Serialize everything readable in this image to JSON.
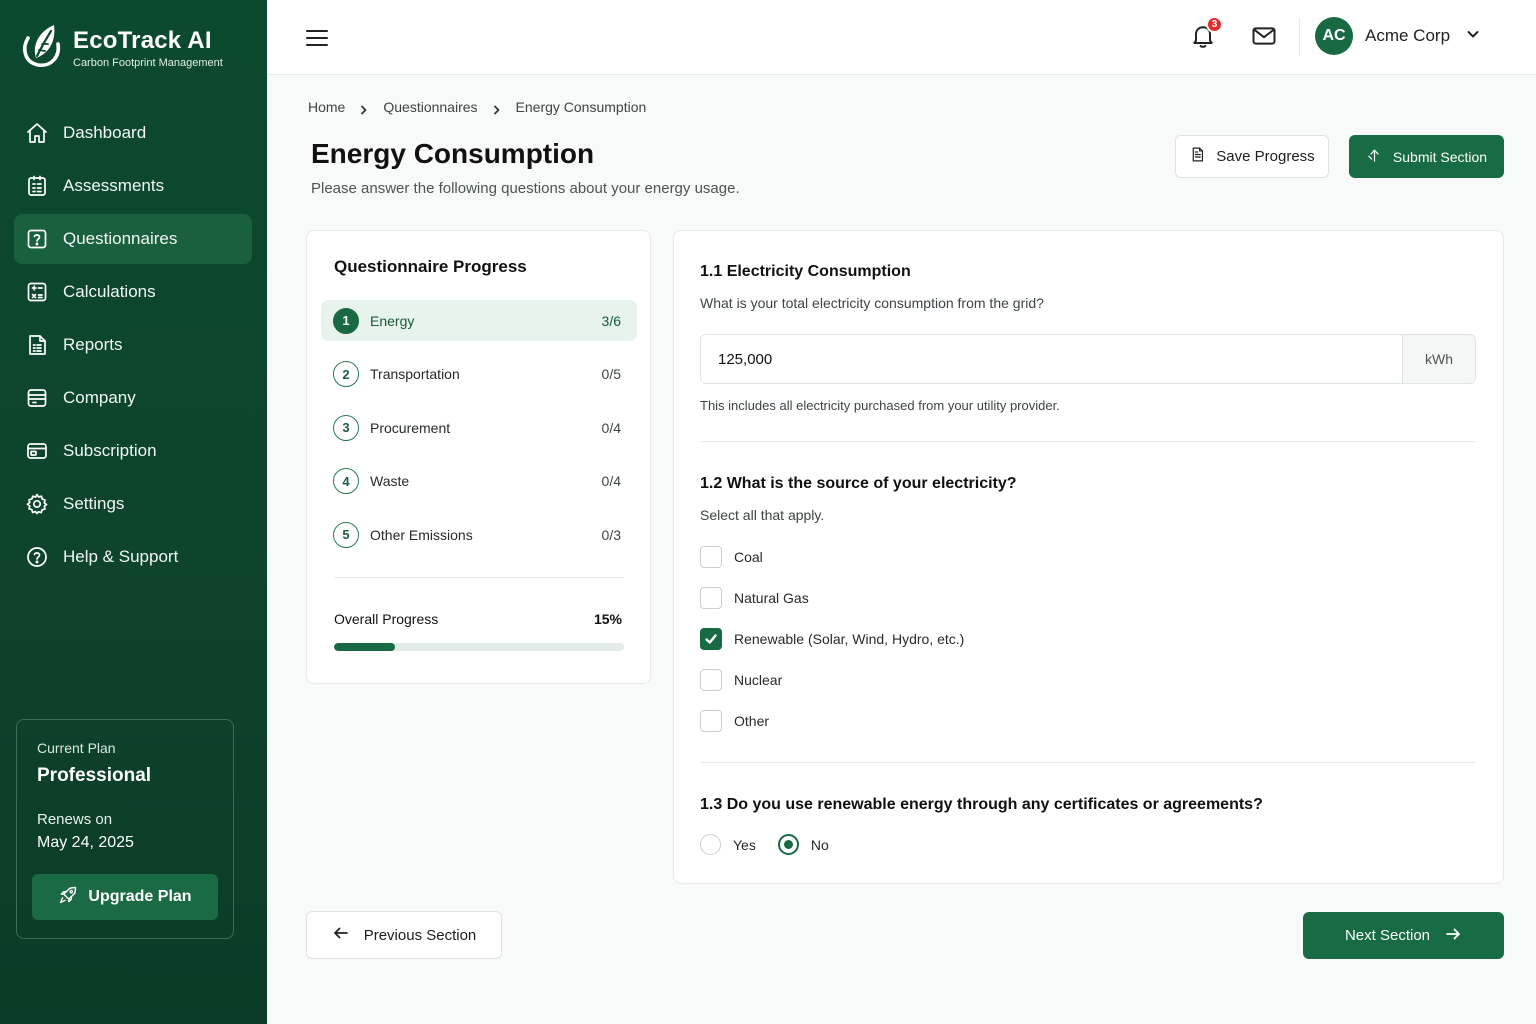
{
  "brand": {
    "name": "EcoTrack AI",
    "tagline": "Carbon Footprint Management",
    "logo_icon": "leaf-icon"
  },
  "sidebar": {
    "items": [
      {
        "label": "Dashboard",
        "icon": "home-icon",
        "active": false
      },
      {
        "label": "Assessments",
        "icon": "clipboard-icon",
        "active": false
      },
      {
        "label": "Questionnaires",
        "icon": "question-square-icon",
        "active": true
      },
      {
        "label": "Calculations",
        "icon": "calculator-icon",
        "active": false
      },
      {
        "label": "Reports",
        "icon": "report-icon",
        "active": false
      },
      {
        "label": "Company",
        "icon": "building-icon",
        "active": false
      },
      {
        "label": "Subscription",
        "icon": "card-icon",
        "active": false
      },
      {
        "label": "Settings",
        "icon": "gear-icon",
        "active": false
      },
      {
        "label": "Help & Support",
        "icon": "help-circle-icon",
        "active": false
      }
    ],
    "plan": {
      "label": "Current Plan",
      "name": "Professional",
      "renews_label": "Renews on",
      "renews_date": "May 24, 2025",
      "upgrade_label": "Upgrade Plan"
    }
  },
  "topbar": {
    "notification_count": "3",
    "user_initials": "AC",
    "user_name": "Acme Corp"
  },
  "breadcrumb": [
    "Home",
    "Questionnaires",
    "Energy Consumption"
  ],
  "header": {
    "title": "Energy Consumption",
    "subtitle": "Please answer the following questions about your energy usage.",
    "save_label": "Save Progress",
    "submit_label": "Submit Section"
  },
  "progress": {
    "title": "Questionnaire Progress",
    "steps": [
      {
        "num": "1",
        "label": "Energy",
        "count": "3/6",
        "active": true
      },
      {
        "num": "2",
        "label": "Transportation",
        "count": "0/5",
        "active": false
      },
      {
        "num": "3",
        "label": "Procurement",
        "count": "0/4",
        "active": false
      },
      {
        "num": "4",
        "label": "Waste",
        "count": "0/4",
        "active": false
      },
      {
        "num": "5",
        "label": "Other Emissions",
        "count": "0/3",
        "active": false
      }
    ],
    "overall_label": "Overall Progress",
    "overall_value": "15%",
    "overall_fraction": 0.21
  },
  "questions": {
    "q1": {
      "title": "1.1 Electricity Consumption",
      "prompt": "What is your total electricity consumption from the grid?",
      "value": "125,000",
      "unit": "kWh",
      "help": "This includes all electricity purchased from your utility provider."
    },
    "q2": {
      "title": "1.2 What is the source of your electricity?",
      "prompt": "Select all that apply.",
      "options": [
        {
          "label": "Coal",
          "checked": false
        },
        {
          "label": "Natural Gas",
          "checked": false
        },
        {
          "label": "Renewable (Solar, Wind, Hydro, etc.)",
          "checked": true
        },
        {
          "label": "Nuclear",
          "checked": false
        },
        {
          "label": "Other",
          "checked": false
        }
      ]
    },
    "q3": {
      "title": "1.3 Do you use renewable energy through any certificates or agreements?",
      "options": [
        {
          "label": "Yes",
          "selected": false
        },
        {
          "label": "No",
          "selected": true
        }
      ]
    }
  },
  "footer": {
    "prev_label": "Previous Section",
    "next_label": "Next Section"
  },
  "colors": {
    "primary": "#176a41",
    "sidebar": "#0c4a2f",
    "badge": "#e22d2d"
  }
}
